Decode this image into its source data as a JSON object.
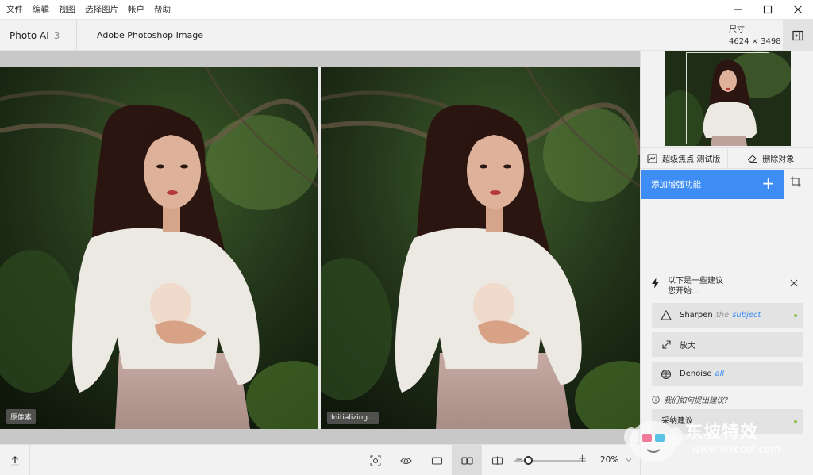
{
  "menu": {
    "items": [
      "文件",
      "编辑",
      "视图",
      "选择图片",
      "帐户",
      "帮助"
    ]
  },
  "window_controls": {
    "minimize_icon": "minimize-icon",
    "maximize_icon": "maximize-icon",
    "close_icon": "close-icon"
  },
  "header": {
    "app_name": "Photo AI",
    "image_count": "3",
    "file_name": "Adobe Photoshop Image",
    "size_label": "尺寸",
    "size_value": "4624 × 3498"
  },
  "canvas": {
    "left_label": "原像素",
    "right_label": "Initializing..."
  },
  "toolbar": {
    "zoom_value": "20%",
    "zoom_level": 0.2
  },
  "panel": {
    "model_left": "超级焦点 测试版",
    "model_right": "删除对象",
    "add_enhance": "添加增强功能",
    "suggestions_title_line1": "以下是一些建议",
    "suggestions_title_line2": "您开始...",
    "suggestions": [
      {
        "main": "Sharpen",
        "muted": "the",
        "accent": "subject",
        "icon": "triangle-icon"
      },
      {
        "main": "放大",
        "muted": "",
        "accent": "",
        "icon": "expand-arrows-icon"
      },
      {
        "main": "Denoise",
        "muted": "",
        "accent": "all",
        "icon": "grid-circle-icon"
      }
    ],
    "how_link": "我们如何提出建议?",
    "adopt": "采纳建议"
  },
  "watermark": {
    "text": "东坡特效",
    "url": "www.vixcool.com"
  },
  "colors": {
    "accent": "#3d8df5",
    "status_dot": "#8bc34a"
  }
}
